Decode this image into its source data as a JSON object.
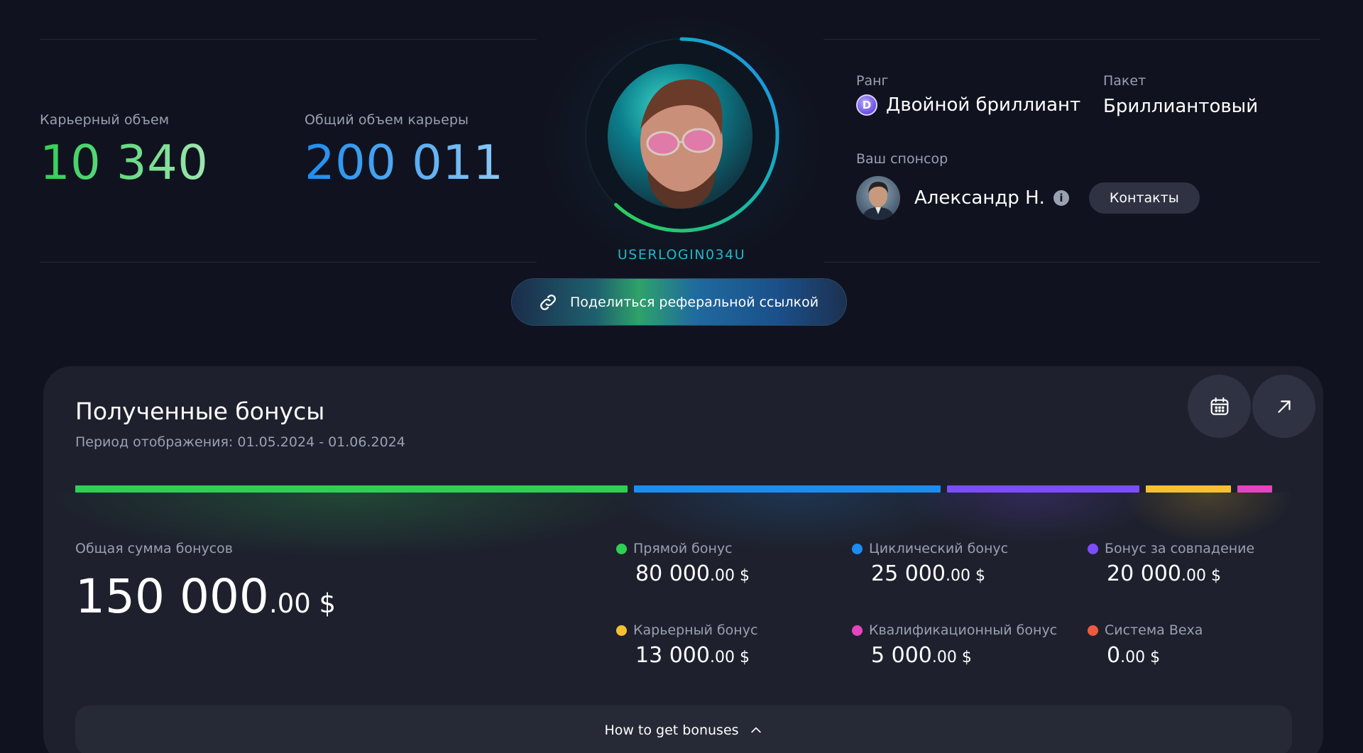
{
  "career": {
    "volume_label": "Карьерный объем",
    "volume_value": "10 340",
    "total_label": "Общий объем карьеры",
    "total_value": "200 011"
  },
  "profile": {
    "username": "USERLOGIN034U",
    "ring_progress": 0.62,
    "share_label": "Поделиться реферальной ссылкой"
  },
  "rank": {
    "label": "Ранг",
    "badge_letter": "D",
    "value": "Двойной бриллиант"
  },
  "package": {
    "label": "Пакет",
    "value": "Бриллиантовый"
  },
  "sponsor": {
    "label": "Ваш спонсор",
    "name": "Александр Н.",
    "info_glyph": "i",
    "contacts_label": "Контакты"
  },
  "bonuses": {
    "title": "Полученные бонусы",
    "period": "Период отображения: 01.05.2024 - 01.06.2024",
    "total_label": "Общая сумма бонусов",
    "total_main": "150 000",
    "total_cents": ".00 $",
    "items": [
      {
        "label": "Прямой бонус",
        "main": "80 000",
        "cents": ".00 $",
        "color": "#2fcf55"
      },
      {
        "label": "Циклический бонус",
        "main": "25 000",
        "cents": ".00 $",
        "color": "#1c8df0"
      },
      {
        "label": "Бонус за совпадение",
        "main": "20 000",
        "cents": ".00 $",
        "color": "#7c4dff"
      },
      {
        "label": "Карьерный бонус",
        "main": "13 000",
        "cents": ".00 $",
        "color": "#f7c030"
      },
      {
        "label": "Квалификационный бонус",
        "main": "5 000",
        "cents": ".00 $",
        "color": "#e544c0"
      },
      {
        "label": "Система Веха",
        "main": "0",
        "cents": ".00 $",
        "color": "#ef5a3a"
      }
    ],
    "distribution": [
      {
        "name": "Прямой бонус",
        "share": 0.4636,
        "color": "#2fcf55"
      },
      {
        "name": "Циклический бонус",
        "share": 0.2577,
        "color": "#1c8df0"
      },
      {
        "name": "Бонус за совпадение",
        "share": 0.1611,
        "color": "#7c4dff"
      },
      {
        "name": "Карьерный бонус",
        "share": 0.0715,
        "color": "#f7c030"
      },
      {
        "name": "Квалификационный бонус",
        "share": 0.0295,
        "color": "#e544c0"
      }
    ],
    "calendar_icon": "calendar-icon",
    "expand_icon": "arrow-up-right-icon",
    "howto_label": "How to get bonuses"
  }
}
